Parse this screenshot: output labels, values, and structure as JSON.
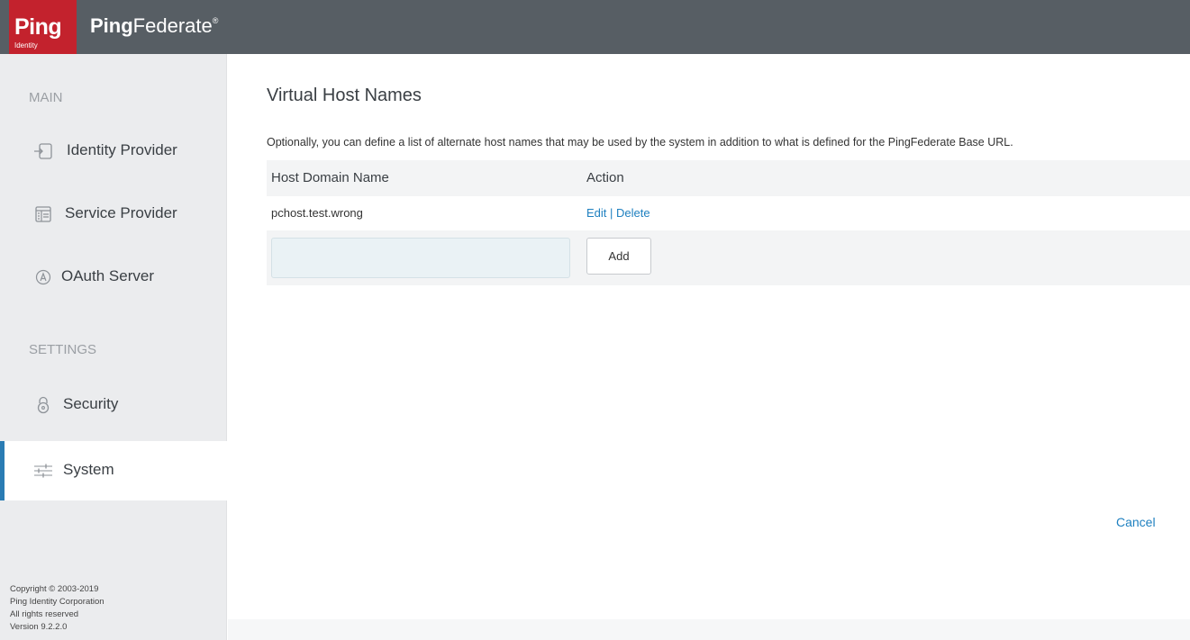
{
  "header": {
    "logo_word": "Ping",
    "logo_sub": "Identity",
    "app_name_bold": "Ping",
    "app_name_rest": "Federate",
    "app_name_mark": "®",
    "bg_color": "#575e64",
    "logo_color": "#c3222d"
  },
  "sidebar": {
    "main_label": "MAIN",
    "settings_label": "SETTINGS",
    "items": [
      {
        "label": "Identity Provider",
        "icon": "identity-provider-icon"
      },
      {
        "label": "Service Provider",
        "icon": "service-provider-icon"
      },
      {
        "label": "OAuth Server",
        "icon": "oauth-server-icon"
      },
      {
        "label": "Security",
        "icon": "lock-icon"
      },
      {
        "label": "System",
        "icon": "sliders-icon",
        "active": true
      }
    ],
    "footer": {
      "copyright": "Copyright © 2003-2019",
      "company": "Ping Identity Corporation",
      "rights": "All rights reserved",
      "version": "Version 9.2.2.0"
    }
  },
  "main": {
    "title": "Virtual Host Names",
    "description": "Optionally, you can define a list of alternate host names that may be used by the system in addition to what is defined for the PingFederate Base URL.",
    "table": {
      "headers": [
        "Host Domain Name",
        "Action"
      ],
      "rows": [
        {
          "host": "pchost.test.wrong",
          "edit": "Edit",
          "separator": "|",
          "delete": "Delete"
        }
      ]
    },
    "new_host": {
      "value": "",
      "placeholder": ""
    },
    "add_label": "Add",
    "cancel_label": "Cancel"
  },
  "colors": {
    "accent": "#1f80c0",
    "active_bar": "#2a7cb4",
    "sidebar_bg": "#ebecee"
  }
}
